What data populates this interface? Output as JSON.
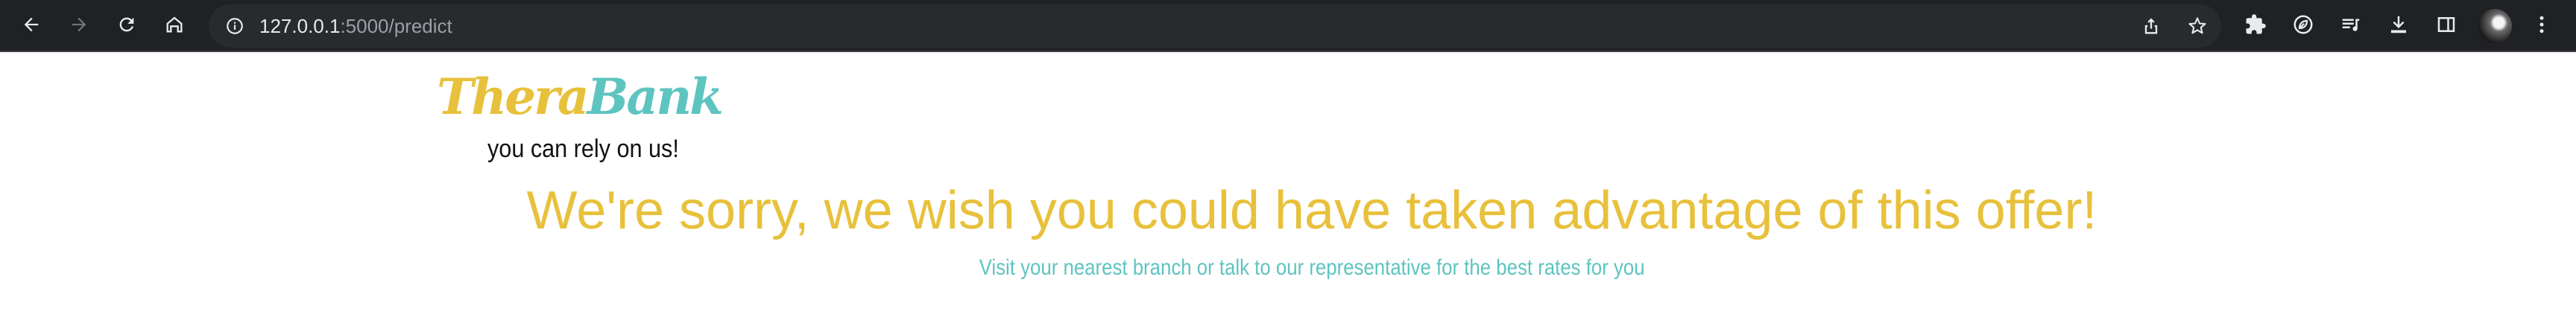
{
  "browser": {
    "url": {
      "host": "127.0.0.1",
      "rest": ":5000/predict"
    },
    "nav_icons": [
      "back-arrow-icon",
      "forward-arrow-icon",
      "reload-icon",
      "home-icon"
    ],
    "omnibox_icons": [
      "info-icon",
      "share-icon",
      "star-icon"
    ],
    "toolbar_icons": [
      "extensions-puzzle-icon",
      "leaf-extension-icon",
      "media-playlist-icon",
      "download-icon",
      "side-panel-icon",
      "profile-avatar",
      "more-menu-icon"
    ],
    "colors": {
      "toolbar_bg": "#202124",
      "omnibox_bg": "#282a2d",
      "icon": "#e8eaed",
      "icon_disabled": "#6f7378"
    }
  },
  "page": {
    "logo": {
      "part1": "Thera",
      "part2": "Bank"
    },
    "tagline": "you can rely on us!",
    "headline": "We're sorry, we wish you could have taken advantage of this offer!",
    "subtext": "Visit your nearest branch or talk to our representative for the best rates for you",
    "colors": {
      "brand_yellow": "#e8c13c",
      "brand_teal": "#5ec4c0"
    }
  }
}
